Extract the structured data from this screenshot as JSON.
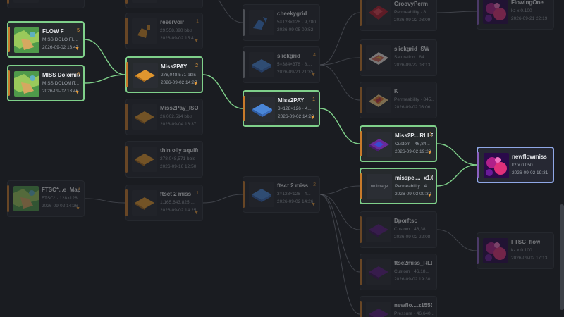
{
  "nodes": [
    {
      "id": "n_top_left",
      "title": "",
      "sub": "",
      "date": "",
      "badge": "",
      "cls": "dim",
      "bar": "#c87a2a",
      "thumb": "blank"
    },
    {
      "id": "n_flowf",
      "title": "FLOW F",
      "sub": "MISS DOLO FL...",
      "date": "2026-09-02 13:47",
      "badge": "5",
      "cls": "sel",
      "bar": "#c87a2a",
      "thumb": "map"
    },
    {
      "id": "n_missdol",
      "title": "MISS Dolomite",
      "sub": "MISS DOLOMIT...",
      "date": "2026-09-02 13:46",
      "badge": "6",
      "cls": "sel",
      "bar": "#c87a2a",
      "thumb": "map"
    },
    {
      "id": "n_ftsc",
      "title": "FTSC*...e_Map",
      "sub": "FTSC* · 128×128",
      "date": "2026-09-02 14:26",
      "badge": "1",
      "cls": "dim",
      "bar": "#c87a2a",
      "thumb": "map"
    },
    {
      "id": "n_c2top",
      "title": "",
      "sub": "",
      "date": "",
      "badge": "",
      "cls": "dim",
      "bar": "#c87a2a",
      "thumb": "blank"
    },
    {
      "id": "n_reservoir",
      "title": "reservoir",
      "sub": "29,558,890 bbls",
      "date": "2026-09-02 15:41",
      "badge": "1",
      "cls": "dim",
      "bar": "#c87a2a",
      "thumb": "orange-small"
    },
    {
      "id": "n_miss2pay",
      "title": "Miss2PAY",
      "sub": "278,048,571 bbls",
      "date": "2026-09-02 14:27",
      "badge": "2",
      "cls": "sel",
      "bar": "#c87a2a",
      "thumb": "orange"
    },
    {
      "id": "n_miss2pay_iso",
      "title": "Miss2Pay_ISO",
      "sub": "26,002,514 bbls",
      "date": "2026-09-04 16:37",
      "badge": "",
      "cls": "dim",
      "bar": "#c87a2a",
      "thumb": "orange"
    },
    {
      "id": "n_thinoily",
      "title": "thin oily aquifer",
      "sub": "278,048,571 bbls",
      "date": "2026-09-16 12:50",
      "badge": "",
      "cls": "dim",
      "bar": "#c87a2a",
      "thumb": "orange"
    },
    {
      "id": "n_ftsct2miss",
      "title": "ftsct 2 miss",
      "sub": "1,165,643,825 ...",
      "date": "2026-09-02 14:25",
      "badge": "1",
      "cls": "dim",
      "bar": "#c87a2a",
      "thumb": "orange"
    },
    {
      "id": "n_cheeky",
      "title": "cheekygrid",
      "sub": "5×128×126 · 9,780...",
      "date": "2026-09-05 09:52",
      "badge": "",
      "cls": "dim",
      "bar": "#8a8d94",
      "thumb": "blue-small"
    },
    {
      "id": "n_slickgrid",
      "title": "slickgrid",
      "sub": "5×384×378 · 8,...",
      "date": "2026-09-21 21:35",
      "badge": "4",
      "cls": "dim",
      "bar": "#8a8d94",
      "thumb": "blue"
    },
    {
      "id": "n_miss2pay3",
      "title": "Miss2PAY",
      "sub": "3×128×126 · 4...",
      "date": "2026-09-02 14:28",
      "badge": "1",
      "cls": "sel",
      "bar": "#c87a2a",
      "thumb": "blue"
    },
    {
      "id": "n_ftsct2miss3",
      "title": "ftsct 2 miss",
      "sub": "3×128×126 · 4...",
      "date": "2026-09-02 14:26",
      "badge": "2",
      "cls": "dim",
      "bar": "#c87a2a",
      "thumb": "blue"
    },
    {
      "id": "n_groovy",
      "title": "GroovyPerm",
      "sub": "Permeability · 8...",
      "date": "2026-09-22 03:09",
      "badge": "",
      "cls": "dim",
      "bar": "#c87a2a",
      "thumb": "red"
    },
    {
      "id": "n_slicksw",
      "title": "slickgrid_SW",
      "sub": "Saturation · 84...",
      "date": "2026-09-22 03:13",
      "badge": "",
      "cls": "dim",
      "bar": "#c87a2a",
      "thumb": "red-sw"
    },
    {
      "id": "n_k",
      "title": "K",
      "sub": "Permeability · 845...",
      "date": "2026-09-02 03:06",
      "badge": "",
      "cls": "dim",
      "bar": "#c87a2a",
      "thumb": "k"
    },
    {
      "id": "n_miss2prll",
      "title": "Miss2P....RLL3_2",
      "sub": "Custom · 46,84...",
      "date": "2026-09-02 19:29",
      "badge": "1",
      "cls": "sel",
      "bar": "#c87a2a",
      "thumb": "purple"
    },
    {
      "id": "n_misspe",
      "title": "misspe...._x1.00",
      "sub": "Permeability · 4...",
      "date": "2026-09-03 00:30",
      "badge": "1",
      "cls": "sel",
      "bar": "#c87a2a",
      "thumb": "noimg"
    },
    {
      "id": "n_dporftsc",
      "title": "Dporftsc",
      "sub": "Custom · 46,38...",
      "date": "2026-09-02 22:08",
      "badge": "",
      "cls": "dim",
      "bar": "#c87a2a",
      "thumb": "purple-dark"
    },
    {
      "id": "n_ftsc2miss",
      "title": "ftsc2miss_RLL3",
      "sub": "Custom · 46,18...",
      "date": "2026-09-02 19:30",
      "badge": "",
      "cls": "dim",
      "bar": "#c87a2a",
      "thumb": "purple-dark"
    },
    {
      "id": "n_newflo",
      "title": "newflo....z15538",
      "sub": "Pressure · 46,640...",
      "date": "",
      "badge": "",
      "cls": "dim",
      "bar": "#c87a2a",
      "thumb": "purple-dark"
    },
    {
      "id": "n_flowingone",
      "title": "FlowingOne",
      "sub": "kz x 0.100",
      "date": "2026-09-21 22:19",
      "badge": "",
      "cls": "dim",
      "bar": "#8a5fbf",
      "thumb": "heat"
    },
    {
      "id": "n_newflowmiss",
      "title": "newflowmiss",
      "sub": "kz x 0.050",
      "date": "2026-09-02 19:31",
      "badge": "",
      "cls": "selblue",
      "bar": "#8a5fbf",
      "thumb": "heat"
    },
    {
      "id": "n_ftscflow",
      "title": "FTSC_flow",
      "sub": "kz x 0.100",
      "date": "2026-09-02 17:13",
      "badge": "",
      "cls": "dim",
      "bar": "#8a5fbf",
      "thumb": "heat"
    }
  ],
  "no_image_label": "no image",
  "colors": {
    "edge_active": "#7fd08a",
    "edge_dim": "#5a5e66",
    "edge_blue": "#8fa7e6",
    "accent_orange": "#e39a3c"
  }
}
